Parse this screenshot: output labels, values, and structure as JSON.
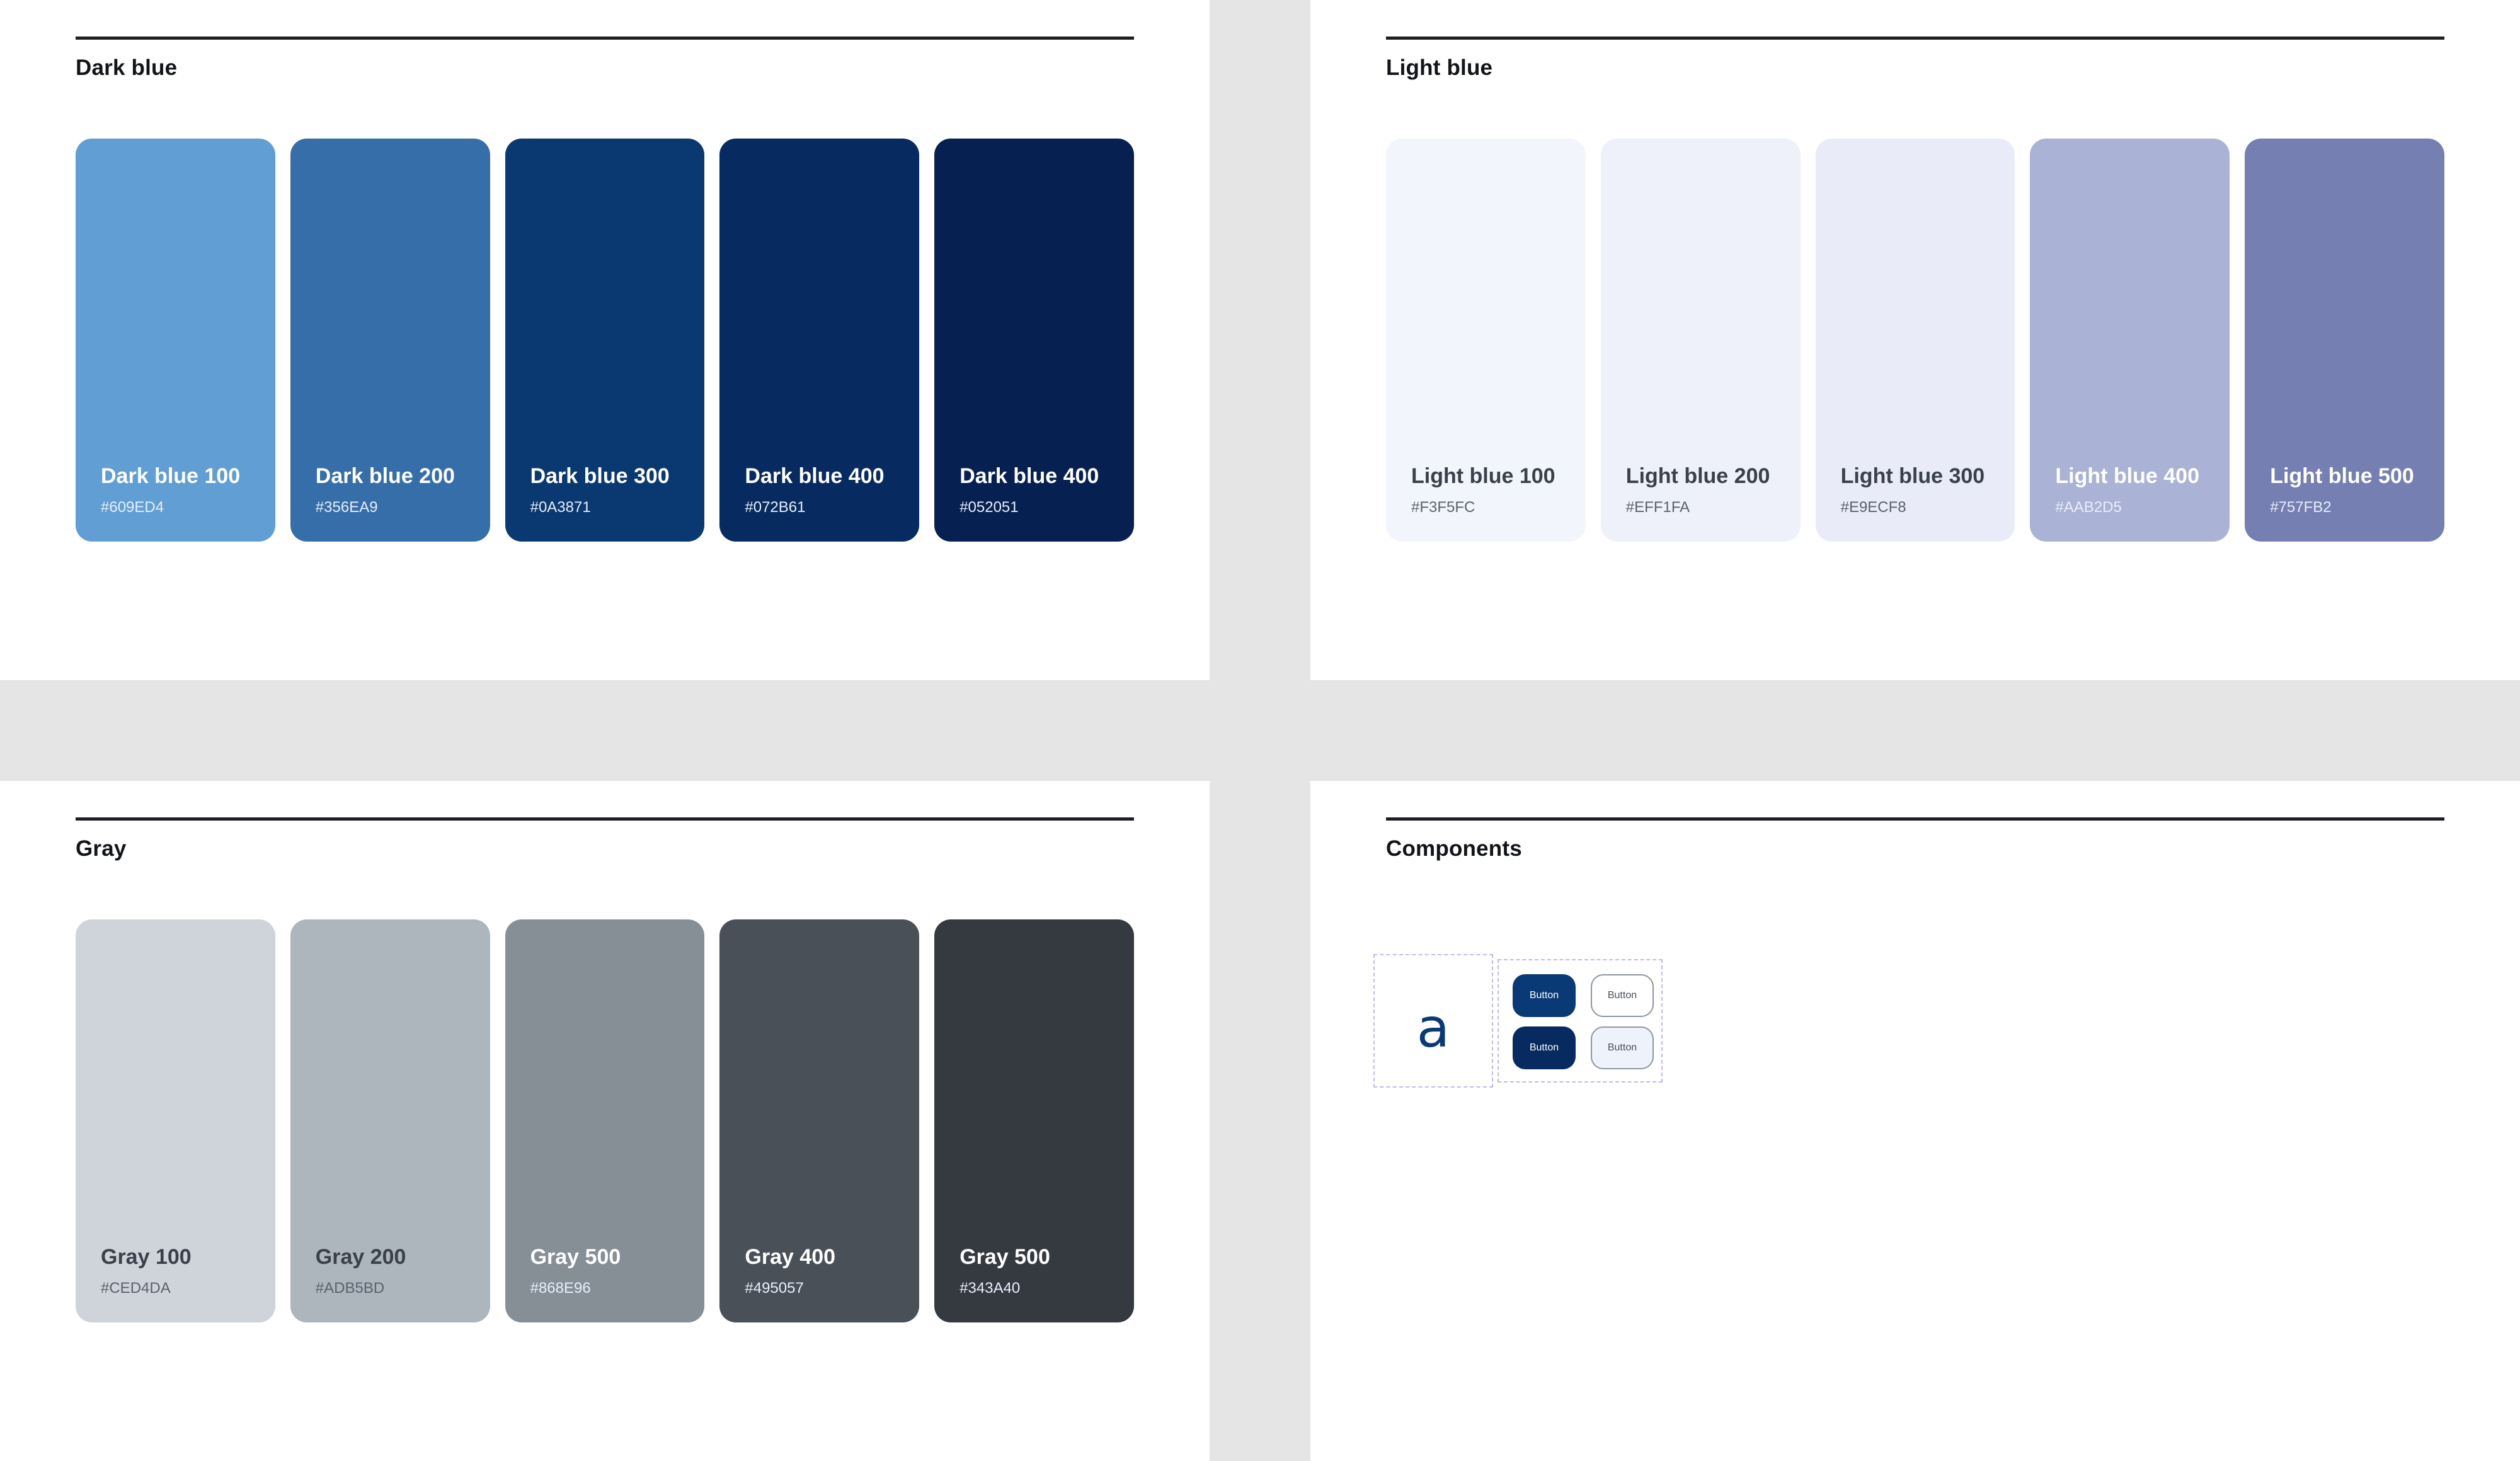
{
  "sections": {
    "dark_blue": {
      "title": "Dark blue",
      "swatches": [
        {
          "name": "Dark blue 100",
          "hex": "#609ED4",
          "color": "#609ED4"
        },
        {
          "name": "Dark blue 200",
          "hex": "#356EA9",
          "color": "#356EA9"
        },
        {
          "name": "Dark blue 300",
          "hex": "#0A3871",
          "color": "#0A3871"
        },
        {
          "name": "Dark blue 400",
          "hex": "#072B61",
          "color": "#072B61"
        },
        {
          "name": "Dark blue 400",
          "hex": "#052051",
          "color": "#052051"
        }
      ]
    },
    "light_blue": {
      "title": "Light blue",
      "swatches": [
        {
          "name": "Light blue 100",
          "hex": "#F3F5FC",
          "color": "#F3F5FC"
        },
        {
          "name": "Light blue 200",
          "hex": "#EFF1FA",
          "color": "#EFF1FA"
        },
        {
          "name": "Light blue 300",
          "hex": "#E9ECF8",
          "color": "#E9ECF8"
        },
        {
          "name": "Light blue 400",
          "hex": "#AAB2D5",
          "color": "#AAB2D5"
        },
        {
          "name": "Light blue 500",
          "hex": "#757FB2",
          "color": "#757FB2"
        }
      ]
    },
    "gray": {
      "title": "Gray",
      "swatches": [
        {
          "name": "Gray 100",
          "hex": "#CED4DA",
          "color": "#CED4DA"
        },
        {
          "name": "Gray 200",
          "hex": "#ADB5BD",
          "color": "#ADB5BD"
        },
        {
          "name": "Gray 500",
          "hex": "#868E96",
          "color": "#868E96"
        },
        {
          "name": "Gray 400",
          "hex": "#495057",
          "color": "#495057"
        },
        {
          "name": "Gray 500",
          "hex": "#343A40",
          "color": "#343A40"
        }
      ]
    },
    "components": {
      "title": "Components",
      "glyph": "a",
      "buttons": [
        {
          "label": "Button",
          "style": "primary"
        },
        {
          "label": "Button",
          "style": "outline"
        },
        {
          "label": "Button",
          "style": "primary"
        },
        {
          "label": "Button",
          "style": "outline"
        }
      ]
    }
  },
  "colors": {
    "page_background": "#E5E5E5",
    "panel_background": "#FFFFFF",
    "rule": "#1B1F24",
    "component_outline": "#C2B8F2"
  }
}
